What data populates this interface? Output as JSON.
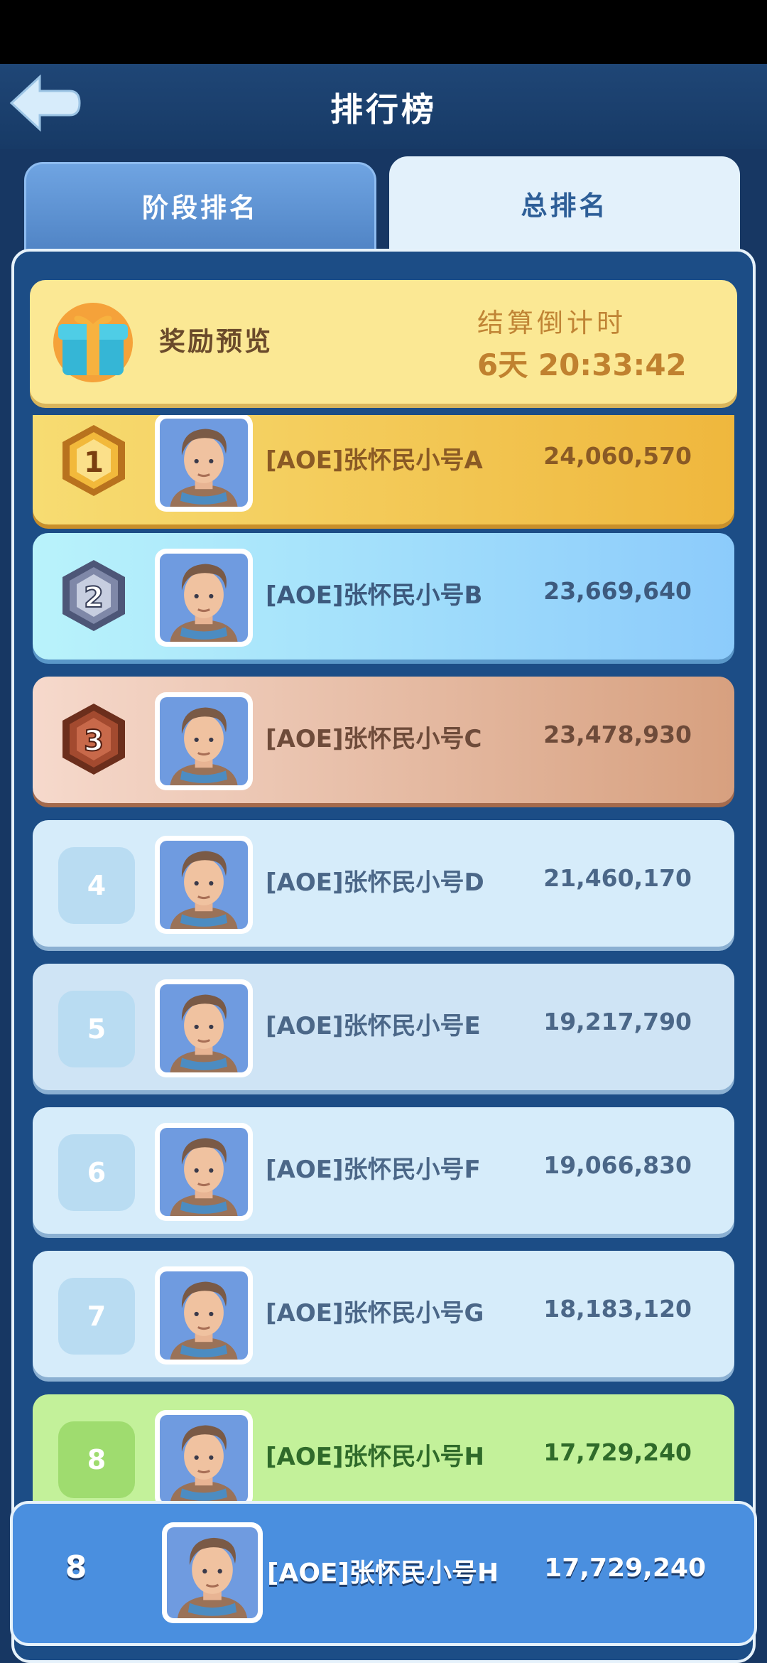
{
  "header": {
    "title": "排行榜",
    "back_icon": "back-arrow-icon"
  },
  "tabs": [
    {
      "label": "阶段排名",
      "selected": false
    },
    {
      "label": "总排名",
      "selected": true
    }
  ],
  "reward": {
    "label": "奖励预览",
    "icon": "gift-icon",
    "countdown_label": "结算倒计时",
    "countdown_value": "6天 20:33:42"
  },
  "rows": [
    {
      "rank": "1",
      "name": "[AOE]张怀民小号A",
      "score": "24,060,570",
      "style": "gold"
    },
    {
      "rank": "2",
      "name": "[AOE]张怀民小号B",
      "score": "23,669,640",
      "style": "silver"
    },
    {
      "rank": "3",
      "name": "[AOE]张怀民小号C",
      "score": "23,478,930",
      "style": "bronze"
    },
    {
      "rank": "4",
      "name": "[AOE]张怀民小号D",
      "score": "21,460,170",
      "style": "normal"
    },
    {
      "rank": "5",
      "name": "[AOE]张怀民小号E",
      "score": "19,217,790",
      "style": "normal"
    },
    {
      "rank": "6",
      "name": "[AOE]张怀民小号F",
      "score": "19,066,830",
      "style": "normal"
    },
    {
      "rank": "7",
      "name": "[AOE]张怀民小号G",
      "score": "18,183,120",
      "style": "normal"
    },
    {
      "rank": "8",
      "name": "[AOE]张怀民小号H",
      "score": "17,729,240",
      "style": "self"
    }
  ],
  "self": {
    "rank": "8",
    "name": "[AOE]张怀民小号H",
    "score": "17,729,240"
  },
  "colors": {
    "gold": "#f2c14a",
    "silver": "#8fd1fb",
    "bronze": "#e5b193",
    "normal": "#d6ecfa",
    "self_row": "#c3f19a",
    "self_bar": "#4a8fdf"
  }
}
